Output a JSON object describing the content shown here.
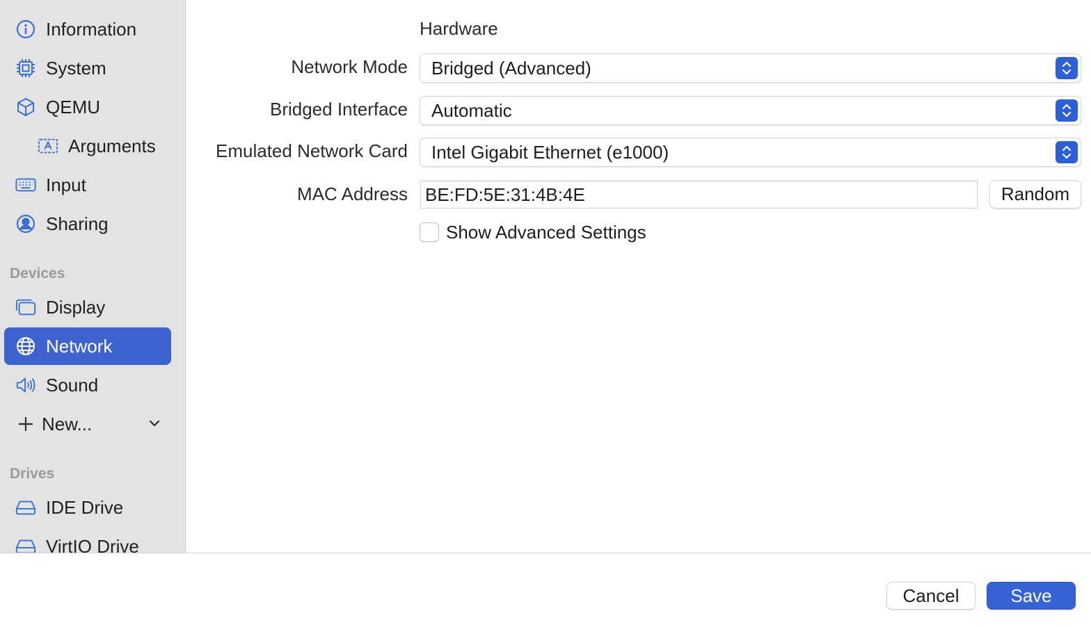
{
  "sidebar": {
    "items": [
      {
        "label": "Information",
        "icon": "info-circle-icon"
      },
      {
        "label": "System",
        "icon": "cpu-icon"
      },
      {
        "label": "QEMU",
        "icon": "cube-icon"
      },
      {
        "label": "Arguments",
        "icon": "text-box-icon"
      },
      {
        "label": "Input",
        "icon": "keyboard-icon"
      },
      {
        "label": "Sharing",
        "icon": "person-circle-icon"
      }
    ],
    "devices_header": "Devices",
    "devices": [
      {
        "label": "Display",
        "icon": "display-icon"
      },
      {
        "label": "Network",
        "icon": "globe-icon",
        "selected": true
      },
      {
        "label": "Sound",
        "icon": "speaker-icon"
      }
    ],
    "new_label": "New...",
    "drives_header": "Drives",
    "drives": [
      {
        "label": "IDE Drive",
        "icon": "drive-icon"
      },
      {
        "label": "VirtIO Drive",
        "icon": "drive-icon"
      }
    ]
  },
  "form": {
    "section_title": "Hardware",
    "network_mode": {
      "label": "Network Mode",
      "value": "Bridged (Advanced)"
    },
    "bridged_interface": {
      "label": "Bridged Interface",
      "value": "Automatic"
    },
    "network_card": {
      "label": "Emulated Network Card",
      "value": "Intel Gigabit Ethernet (e1000)"
    },
    "mac_address": {
      "label": "MAC Address",
      "value": "BE:FD:5E:31:4B:4E",
      "random_label": "Random"
    },
    "advanced": {
      "label": "Show Advanced Settings",
      "checked": false
    }
  },
  "footer": {
    "cancel_label": "Cancel",
    "save_label": "Save"
  },
  "colors": {
    "accent": "#3e63d0",
    "sidebar_bg": "#e3e3e3",
    "icon_blue": "#3b6fd6"
  }
}
